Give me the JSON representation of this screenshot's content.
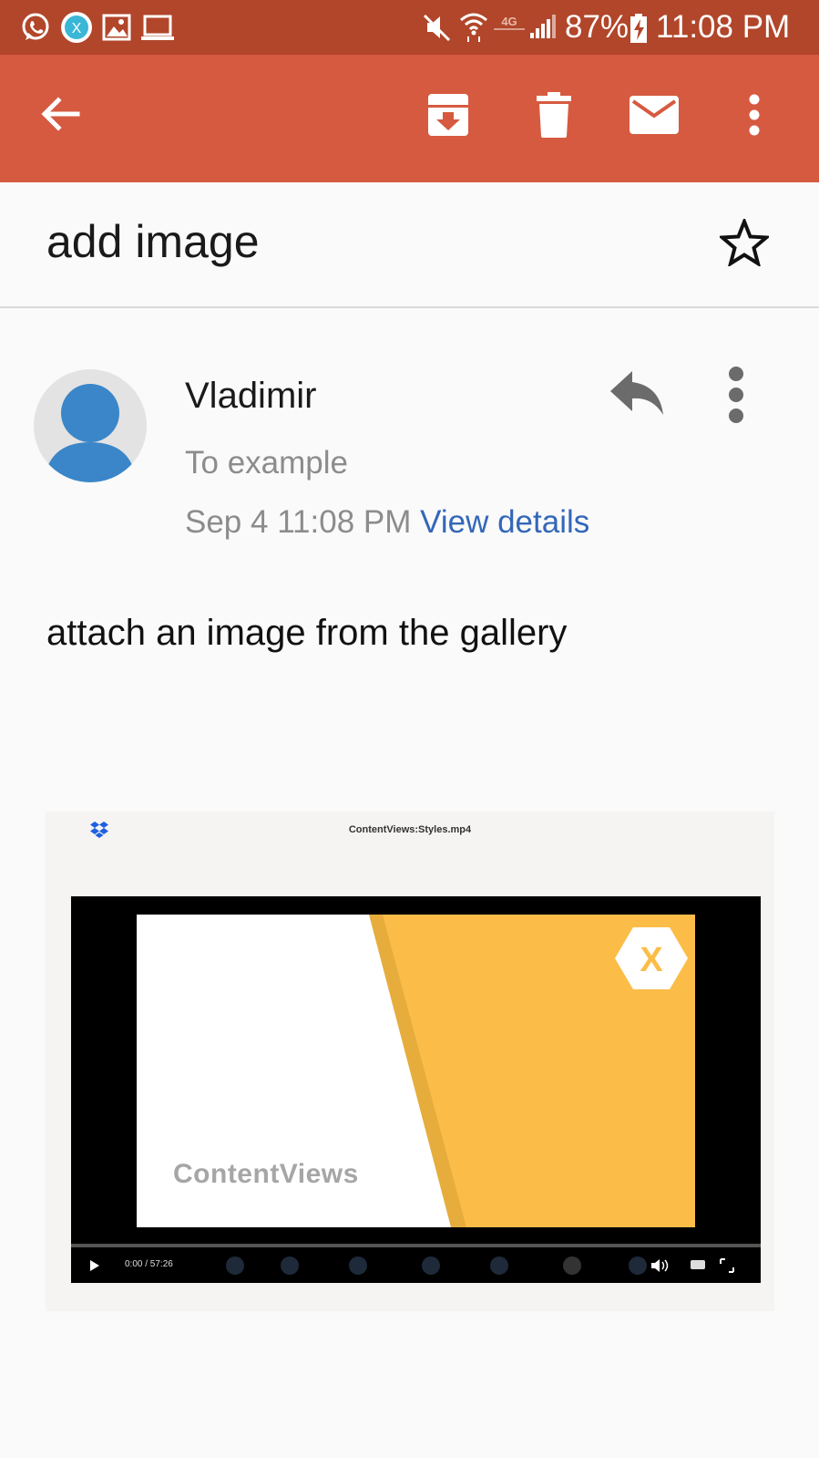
{
  "status_bar": {
    "battery": "87%",
    "time": "11:08 PM",
    "app_icons": [
      "whatsapp-icon",
      "xamarin-icon",
      "gallery-icon",
      "laptop-icon"
    ],
    "system_icons": [
      "mute-icon",
      "wifi-icon",
      "lte-icon",
      "signal-icon",
      "battery-charging-icon"
    ]
  },
  "app_bar": {
    "icons": [
      "back-arrow-icon",
      "archive-icon",
      "delete-icon",
      "mark-unread-icon",
      "more-vert-icon"
    ]
  },
  "email": {
    "subject": "add image",
    "sender": "Vladimir",
    "recipient": "To example",
    "date": "Sep 4 11:08 PM",
    "view_details": "View details",
    "body": "attach an image from the gallery"
  },
  "attachment": {
    "title": "ContentViews:Styles.mp4",
    "slide_label": "ContentViews",
    "time": "0:00 / 57:26",
    "progress": 0
  },
  "colors": {
    "status_bar": "#b1462a",
    "app_bar": "#d65a40",
    "link": "#3367b8",
    "avatar": "#3a86c8",
    "slide_yellow": "#fbbd48"
  }
}
